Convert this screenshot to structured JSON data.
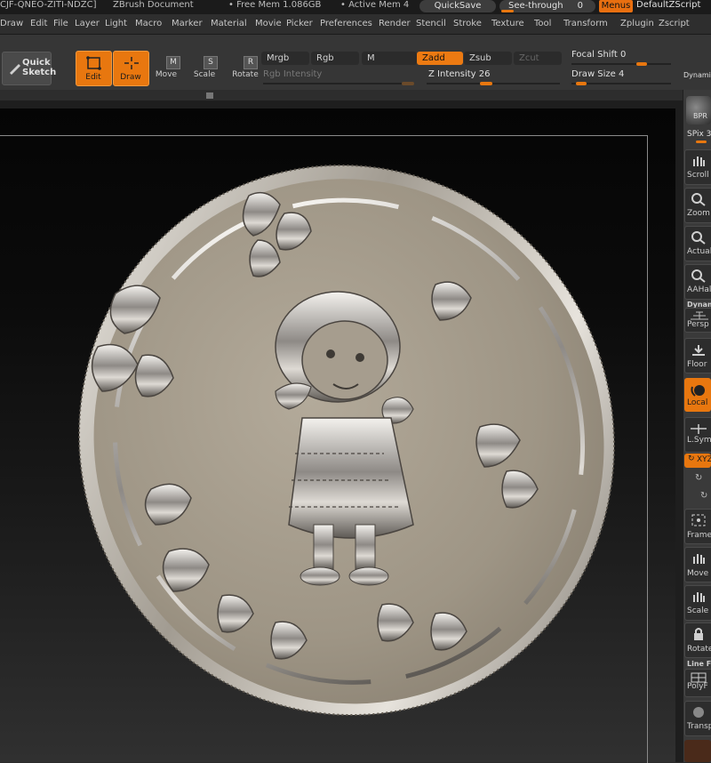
{
  "titlebar": {
    "doc_id": "CJF-QNEO-ZITI-NDZC]",
    "app_title": "ZBrush Document",
    "free_mem": "• Free Mem 1.086GB",
    "active_mem": "• Active Mem 4",
    "quicksave": "QuickSave",
    "see_through": "See-through",
    "see_through_value": "0",
    "menus": "Menus",
    "script": "DefaultZScript"
  },
  "menubar": {
    "items": [
      "Draw",
      "Edit",
      "File",
      "Layer",
      "Light",
      "Macro",
      "Marker",
      "Material",
      "Movie",
      "Picker",
      "Preferences",
      "Render",
      "Stencil",
      "Stroke",
      "Texture",
      "Tool",
      "Transform",
      "Zplugin",
      "Zscript"
    ]
  },
  "toolbar": {
    "quick_sketch": "Quick Sketch",
    "edit": "Edit",
    "draw": "Draw",
    "move": "Move",
    "scale": "Scale",
    "rotate": "Rotate",
    "mrgb": "Mrgb",
    "rgb": "Rgb",
    "m": "M",
    "rgb_intensity": "Rgb Intensity",
    "zadd": "Zadd",
    "zsub": "Zsub",
    "zcut": "Zcut",
    "z_intensity": "Z Intensity 26",
    "focal_shift": "Focal Shift",
    "focal_value": "0",
    "draw_size": "Draw Size",
    "draw_size_value": "4",
    "dynamic": "Dynami"
  },
  "shelf": {
    "bpr": "BPR",
    "spix": "SPix",
    "spix_value": "3",
    "scroll": "Scroll",
    "zoom": "Zoom",
    "actual": "Actual",
    "aahalf": "AAHalf",
    "dynamic": "Dynamic",
    "persp": "Persp",
    "floor": "Floor",
    "local": "Local",
    "lsym": "L.Sym",
    "xyz": "XYZ",
    "frame": "Frame",
    "move": "Move",
    "scale": "Scale",
    "rotate": "Rotate",
    "line_fill": "Line Fill",
    "polyf": "PolyF",
    "transp": "Transp"
  },
  "colors": {
    "accent": "#e8770f",
    "panel": "#363636",
    "coin_face": "#a89f8f",
    "coin_rim": "#cfcac2"
  }
}
